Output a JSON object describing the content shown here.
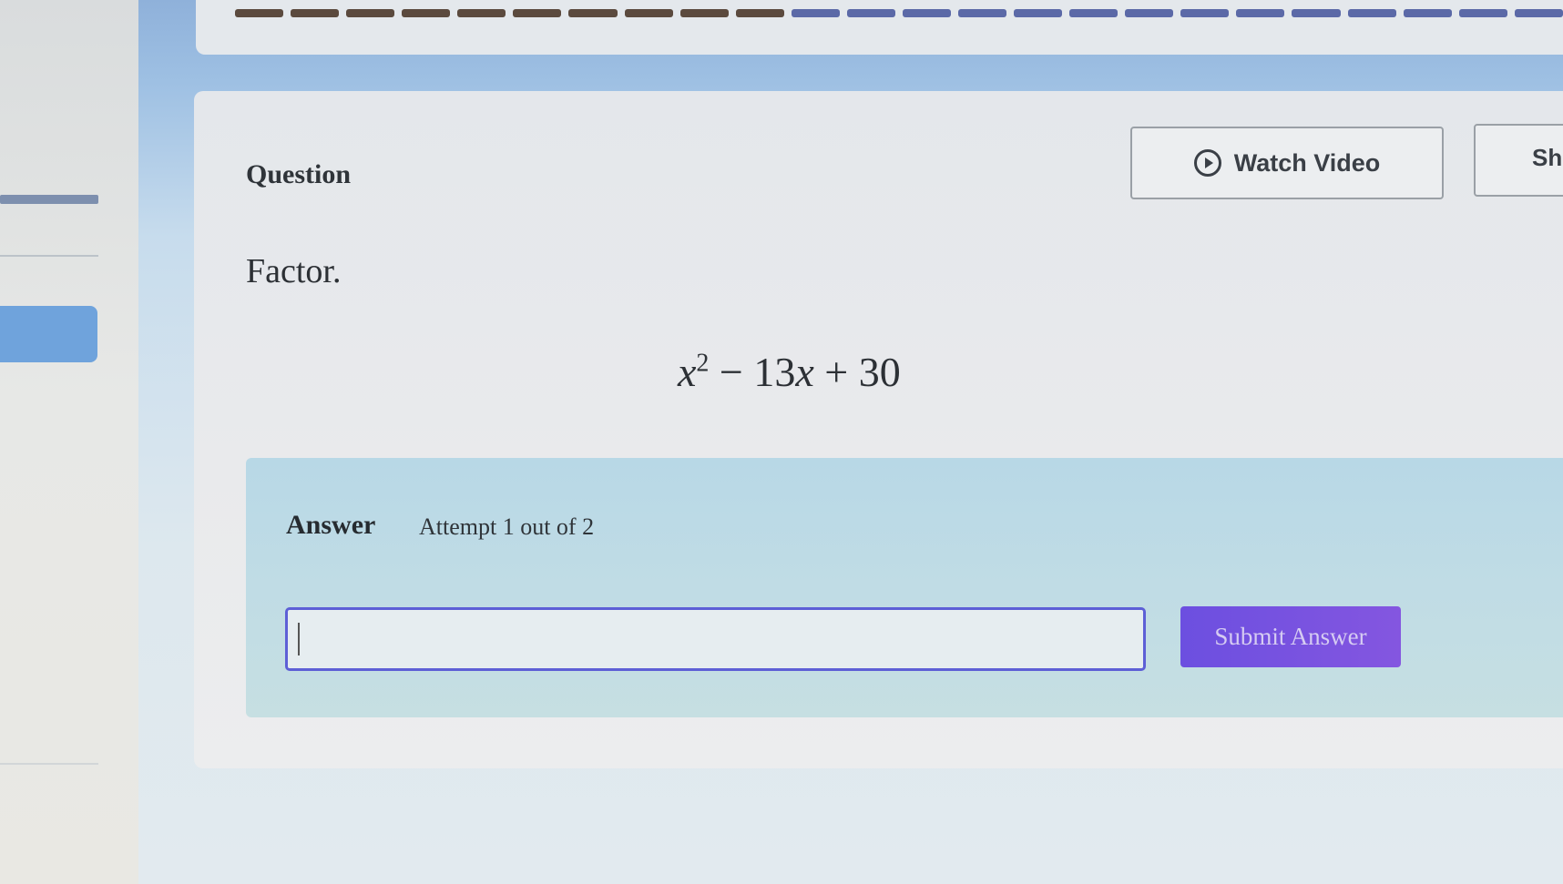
{
  "progress": {
    "done_segments": 10,
    "total_segments": 24
  },
  "question": {
    "label": "Question",
    "watch_video_label": "Watch Video",
    "show_label": "Sh",
    "prompt": "Factor.",
    "expression": {
      "base": "x",
      "exponent": "2",
      "rest_a": " − 13",
      "var": "x",
      "rest_b": " + 30"
    }
  },
  "answer": {
    "label": "Answer",
    "attempt_text": "Attempt 1 out of 2",
    "input_value": "",
    "submit_label": "Submit Answer"
  },
  "colors": {
    "accent": "#6c4fe0",
    "progress_done": "#5b4a3e",
    "progress_todo": "#5b69a7",
    "input_border": "#5d5fd6"
  }
}
